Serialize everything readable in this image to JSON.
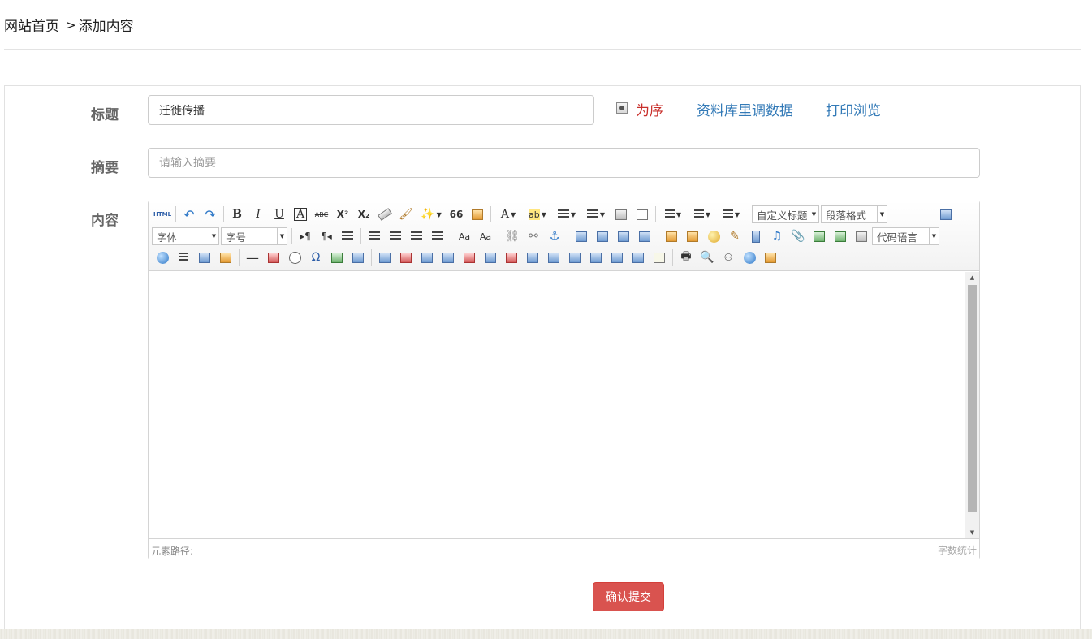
{
  "breadcrumb": {
    "home": "网站首页",
    "separator": ">",
    "current": "添加内容"
  },
  "form": {
    "title_label": "标题",
    "title_value": "迁徙传播",
    "summary_label": "摘要",
    "summary_placeholder": "请输入摘要",
    "content_label": "内容",
    "options": {
      "order": "为序",
      "library": "资料库里调数据",
      "print": "打印浏览"
    }
  },
  "toolbar": {
    "row1_icons": [
      "html-icon",
      "undo-icon",
      "redo-icon",
      "bold-icon",
      "italic-icon",
      "underline-icon",
      "font-border-icon",
      "strikethrough-icon",
      "superscript-icon",
      "subscript-icon",
      "eraser-icon",
      "format-brush-icon",
      "auto-format-icon",
      "blockquote-icon",
      "paste-plain-icon",
      "font-color-icon",
      "highlight-icon",
      "ordered-list-icon",
      "unordered-list-icon",
      "select-all-icon",
      "clear-doc-icon",
      "row-spacing-top-icon",
      "row-spacing-bottom-icon",
      "line-height-icon",
      "preview-icon"
    ],
    "custom_title": "自定义标题",
    "paragraph": "段落格式",
    "font_family": "字体",
    "font_size": "字号",
    "code_language": "代码语言",
    "bold": "B",
    "italic": "I",
    "underline": "U",
    "font_border": "A",
    "strike": "ABC",
    "sup": "X²",
    "sub": "X₂",
    "quote": "66",
    "font_color": "A",
    "highlight": "ab",
    "ltr": "▸¶",
    "rtl": "¶◂",
    "omega": "Ω",
    "aa1": "Aa",
    "aa2": "Aa",
    "html_tag": "HTML"
  },
  "status": {
    "path": "元素路径:",
    "word_count": "字数统计"
  },
  "submit_label": "确认提交",
  "colors": {
    "accent": "#d9534f",
    "link": "#337ab7",
    "order": "#c9302c"
  }
}
